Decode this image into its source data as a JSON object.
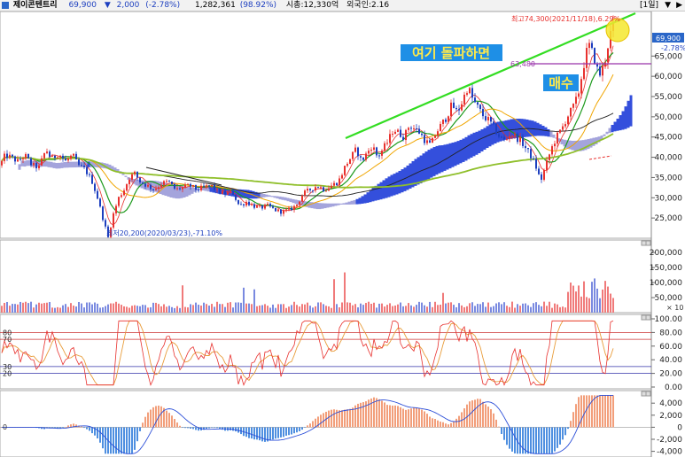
{
  "header": {
    "name": "제이콘텐트리",
    "price": "69,900",
    "arrow": "▼",
    "change": "2,000",
    "change_pct": "(-2.78%)",
    "volume": "1,282,361",
    "volume_pct": "(98.92%)",
    "market_cap": "시총:12,330억",
    "foreign": "외국인:2.16",
    "period": "[1일]",
    "btn_a": "▼",
    "btn_b": "▶"
  },
  "annotations": {
    "breakout_text": "여기 돌파하면",
    "buy_text": "매수",
    "high_label": "최고74,300(2021/11/18),6.29%",
    "low_label": "최저20,200(2020/03/23),-71.10%",
    "line_price": "63,480",
    "current_price": "69,900",
    "current_change": "-2.78%"
  },
  "colors": {
    "up": "#e8312e",
    "down": "#1d3fbf",
    "ichimoku_blue": "#1e3cd8",
    "ichimoku_gray": "#9a9ad8",
    "trendline": "#33dd22",
    "hline": "#9933aa",
    "annotation_bg": "#1e8fe6",
    "annotation_text": "#ffe94a",
    "highlight_circle": "#f5e72e",
    "rsi_line": "#e8312e",
    "rsi_signal": "#e89c3a",
    "macd_pos": "#f29e7a",
    "macd_neg": "#4e8fe0",
    "macd_signal": "#2c4fd8"
  },
  "chart_data": [
    {
      "type": "candlestick",
      "panel": "price",
      "y_ticks": [
        "65,000",
        "60,000",
        "55,000",
        "50,000",
        "45,000",
        "40,000",
        "35,000",
        "30,000",
        "25,000"
      ],
      "ylim": [
        20000,
        76000
      ],
      "overlays": [
        "moving averages",
        "ichimoku cloud"
      ],
      "trend_points": [
        [
          0,
          38000
        ],
        [
          6,
          40500
        ],
        [
          12,
          40000
        ],
        [
          20,
          39000
        ],
        [
          28,
          40500
        ],
        [
          36,
          38000
        ],
        [
          44,
          37500
        ],
        [
          52,
          42000
        ],
        [
          58,
          39500
        ],
        [
          66,
          41000
        ],
        [
          74,
          39000
        ],
        [
          82,
          40500
        ],
        [
          88,
          38000
        ],
        [
          96,
          37000
        ],
        [
          104,
          34000
        ],
        [
          110,
          30000
        ],
        [
          116,
          25000
        ],
        [
          122,
          20200
        ],
        [
          128,
          26000
        ],
        [
          134,
          30000
        ],
        [
          140,
          32000
        ],
        [
          146,
          35000
        ],
        [
          152,
          36000
        ],
        [
          158,
          34000
        ],
        [
          166,
          33000
        ],
        [
          174,
          32000
        ],
        [
          182,
          33500
        ],
        [
          190,
          34000
        ],
        [
          198,
          32000
        ],
        [
          206,
          32500
        ],
        [
          214,
          33000
        ],
        [
          222,
          32000
        ],
        [
          230,
          32500
        ],
        [
          238,
          33000
        ],
        [
          246,
          31500
        ],
        [
          254,
          31000
        ],
        [
          262,
          31500
        ],
        [
          270,
          28000
        ],
        [
          278,
          29000
        ],
        [
          286,
          28000
        ],
        [
          294,
          27500
        ],
        [
          302,
          28000
        ],
        [
          310,
          27000
        ],
        [
          318,
          26500
        ],
        [
          326,
          27000
        ],
        [
          334,
          28000
        ],
        [
          342,
          31000
        ],
        [
          350,
          32000
        ],
        [
          358,
          33000
        ],
        [
          366,
          32000
        ],
        [
          374,
          33000
        ],
        [
          382,
          34000
        ],
        [
          390,
          38000
        ],
        [
          396,
          40000
        ],
        [
          402,
          42000
        ],
        [
          408,
          39000
        ],
        [
          414,
          41000
        ],
        [
          420,
          43000
        ],
        [
          426,
          40000
        ],
        [
          432,
          42000
        ],
        [
          438,
          44000
        ],
        [
          444,
          47000
        ],
        [
          450,
          46000
        ],
        [
          456,
          45000
        ],
        [
          462,
          48000
        ],
        [
          468,
          47000
        ],
        [
          474,
          46000
        ],
        [
          480,
          44000
        ],
        [
          486,
          43000
        ],
        [
          492,
          46000
        ],
        [
          498,
          48000
        ],
        [
          504,
          50000
        ],
        [
          510,
          53000
        ],
        [
          516,
          51000
        ],
        [
          522,
          54000
        ],
        [
          528,
          57500
        ],
        [
          534,
          54000
        ],
        [
          540,
          52000
        ],
        [
          546,
          50000
        ],
        [
          552,
          49000
        ],
        [
          558,
          47000
        ],
        [
          564,
          45000
        ],
        [
          570,
          44000
        ],
        [
          576,
          46000
        ],
        [
          582,
          45000
        ],
        [
          588,
          44000
        ],
        [
          594,
          42000
        ],
        [
          600,
          40000
        ],
        [
          606,
          37000
        ],
        [
          610,
          34000
        ],
        [
          616,
          38000
        ],
        [
          622,
          42000
        ],
        [
          628,
          45000
        ],
        [
          634,
          47000
        ],
        [
          640,
          50000
        ],
        [
          646,
          52000
        ],
        [
          652,
          55000
        ],
        [
          658,
          62000
        ],
        [
          664,
          68000
        ],
        [
          670,
          65000
        ],
        [
          676,
          60000
        ],
        [
          682,
          63000
        ],
        [
          688,
          70000
        ],
        [
          694,
          73500
        ]
      ]
    },
    {
      "type": "bar",
      "panel": "volume",
      "y_ticks": [
        "200,000",
        "150,000",
        "100,000",
        "50,000"
      ],
      "unit_label": "× 10",
      "ylim": [
        0,
        230000
      ]
    },
    {
      "type": "line",
      "panel": "rsi",
      "y_ticks": [
        "100.00",
        "80.00",
        "60.00",
        "40.00",
        "20.00",
        "0.00"
      ],
      "ylim": [
        0,
        100
      ],
      "reference_lines": [
        {
          "label": "80",
          "value": 80
        },
        {
          "label": "70",
          "value": 70
        },
        {
          "label": "30",
          "value": 30
        },
        {
          "label": "20",
          "value": 20
        }
      ]
    },
    {
      "type": "bar",
      "panel": "macd",
      "y_ticks": [
        "4,000",
        "2,000",
        "0",
        "-2,000",
        "-4,000"
      ],
      "left_zero_label": "0",
      "ylim": [
        -4500,
        5500
      ]
    }
  ]
}
